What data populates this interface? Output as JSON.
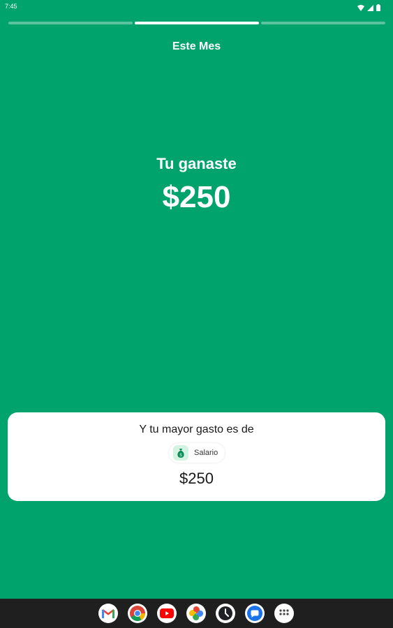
{
  "status_bar": {
    "time": "7:45",
    "icons": [
      "wifi-icon",
      "signal-icon",
      "battery-icon"
    ]
  },
  "progress": {
    "segments": 3,
    "active_index": 1
  },
  "header": {
    "title": "Este Mes"
  },
  "summary": {
    "earned_label": "Tu ganaste",
    "earned_amount": "$250"
  },
  "card": {
    "title": "Y tu mayor gasto es de",
    "category": {
      "label": "Salario",
      "icon": "money-bag-icon"
    },
    "amount": "$250"
  },
  "dock": {
    "apps": [
      "gmail-icon",
      "chrome-icon",
      "youtube-icon",
      "photos-icon",
      "clock-icon",
      "messages-icon",
      "app-drawer-icon"
    ]
  },
  "colors": {
    "background": "#00a36b",
    "card": "#ffffff",
    "chip_icon_bg": "#d4f3e3"
  }
}
